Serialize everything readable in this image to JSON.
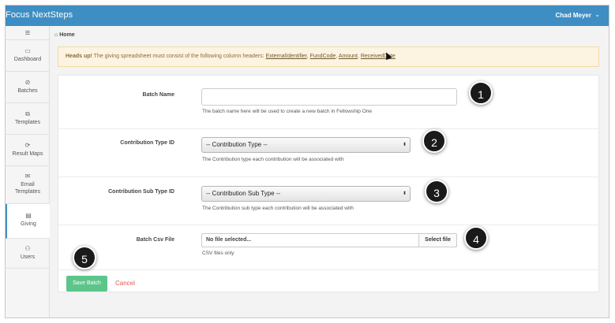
{
  "header": {
    "brand": "Focus NextSteps",
    "user_name": "Chad Meyer",
    "user_caret_icon": "chevron-down-icon"
  },
  "sidebar": {
    "menu_icon": "hamburger-icon",
    "items": [
      {
        "label": "Dashboard",
        "icon": "monitor-icon",
        "glyph": "🖵"
      },
      {
        "label": "Batches",
        "icon": "paperclip-icon",
        "glyph": "📎"
      },
      {
        "label": "Templates",
        "icon": "copy-icon",
        "glyph": "⧉"
      },
      {
        "label": "Result Maps",
        "icon": "refresh-icon",
        "glyph": "⟳"
      },
      {
        "label": "Email Templates",
        "icon": "envelope-icon",
        "glyph": "✉"
      },
      {
        "label": "Giving",
        "icon": "document-icon",
        "glyph": "▤"
      },
      {
        "label": "Users",
        "icon": "users-icon",
        "glyph": "👥"
      }
    ],
    "active": "Giving"
  },
  "breadcrumb": {
    "home_label": "Home"
  },
  "alert": {
    "strong": "Heads up!",
    "text": "The giving spreadsheet must consist of the following column headers:",
    "columns": [
      "ExternalIdentifier",
      "FundCode",
      "Amount",
      "ReceivedDate"
    ]
  },
  "form": {
    "batch_name": {
      "label": "Batch Name",
      "value": "",
      "help": "The batch name here will be used to create a new batch in Fellowship One"
    },
    "contribution_type": {
      "label": "Contribution Type ID",
      "selected": "-- Contribution Type --",
      "help": "The Contribution type each contribution will be associated with"
    },
    "contribution_sub_type": {
      "label": "Contribution Sub Type ID",
      "selected": "-- Contribution Sub Type --",
      "help": "The Contribution sub type each contribution will be associated with"
    },
    "batch_csv": {
      "label": "Batch Csv File",
      "file_text": "No file selected...",
      "button": "Select file",
      "help": "CSV files only"
    },
    "save_label": "Save Batch",
    "cancel_label": "Cancel"
  },
  "annotations": [
    "1",
    "2",
    "3",
    "4",
    "5"
  ],
  "colors": {
    "topbar": "#3f8ec3",
    "alert_bg": "#fcf3e1",
    "save_button": "#5cc58a",
    "cancel_link": "#e2574c",
    "badge": "#1a1a1a"
  }
}
